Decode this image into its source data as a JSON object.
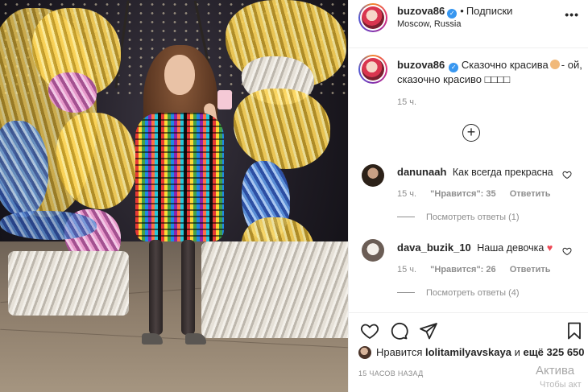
{
  "post": {
    "username": "buzova86",
    "follow_label": "Подписки",
    "location": "Moscow, Russia",
    "more_icon": "more-icon",
    "caption_text": "Сказочно красива",
    "caption_text_2": "- ой, сказочно красиво",
    "caption_emoji_tail": "□□□□",
    "caption_time": "15 ч."
  },
  "comments": [
    {
      "username": "danunaah",
      "text": "Как всегда прекрасна",
      "time": "15 ч.",
      "likes": "\"Нравится\": 35",
      "reply": "Ответить",
      "view_replies": "Посмотреть ответы (1)"
    },
    {
      "username": "dava_buzik_10",
      "text": "Наша девочка",
      "time": "15 ч.",
      "likes": "\"Нравится\": 26",
      "reply": "Ответить",
      "view_replies": "Посмотреть ответы (4)"
    }
  ],
  "footer": {
    "likes_prefix": "Нравится",
    "likes_user": "lolitamilyavskaya",
    "likes_middle": "и",
    "likes_count": "ещё 325 650",
    "timestamp": "15 ЧАСОВ НАЗАД",
    "watermark_1": "Актива",
    "watermark_2": "Чтобы акт"
  },
  "colors": {
    "verified": "#3897f0",
    "heart": "#ed4956",
    "muted": "#8e8e8e"
  }
}
